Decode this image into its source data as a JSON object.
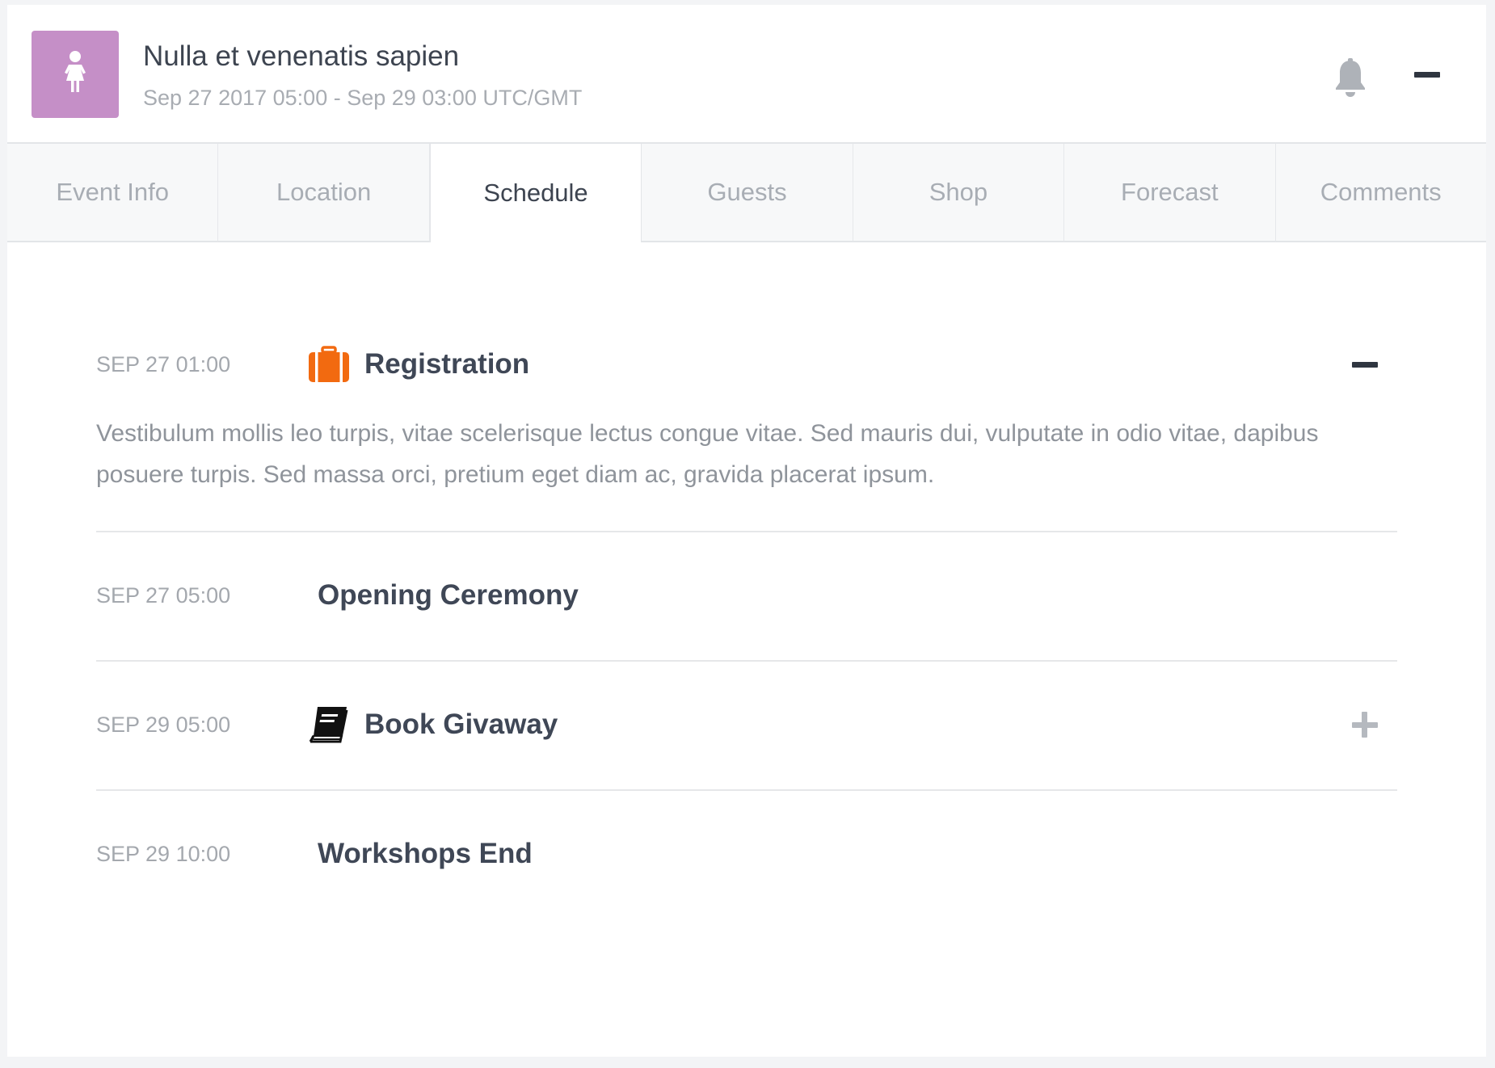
{
  "event": {
    "title": "Nulla et venenatis sapien",
    "dates": "Sep 27 2017 05:00 - Sep 29 03:00 UTC/GMT",
    "avatar_icon": "female-person-icon",
    "avatar_color": "#c58fc7"
  },
  "header_actions": {
    "bell_icon": "bell-icon",
    "collapse_icon": "minus-icon"
  },
  "tabs": [
    {
      "label": "Event Info",
      "active": false
    },
    {
      "label": "Location",
      "active": false
    },
    {
      "label": "Schedule",
      "active": true
    },
    {
      "label": "Guests",
      "active": false
    },
    {
      "label": "Shop",
      "active": false
    },
    {
      "label": "Forecast",
      "active": false
    },
    {
      "label": "Comments",
      "active": false
    }
  ],
  "schedule": [
    {
      "time": "SEP 27 01:00",
      "title": "Registration",
      "icon": "briefcase-icon",
      "icon_color": "#f26a10",
      "expanded": true,
      "toggle": "minus",
      "description": "Vestibulum mollis leo turpis, vitae scelerisque lectus congue vitae. Sed mauris dui, vulputate in odio vitae, dapibus posuere turpis. Sed massa orci, pretium eget diam ac, gravida placerat ipsum."
    },
    {
      "time": "SEP 27 05:00",
      "title": "Opening Ceremony"
    },
    {
      "time": "SEP 29 05:00",
      "title": "Book Givaway",
      "icon": "book-icon",
      "icon_color": "#111111",
      "toggle": "plus"
    },
    {
      "time": "SEP 29 10:00",
      "title": "Workshops End"
    }
  ]
}
